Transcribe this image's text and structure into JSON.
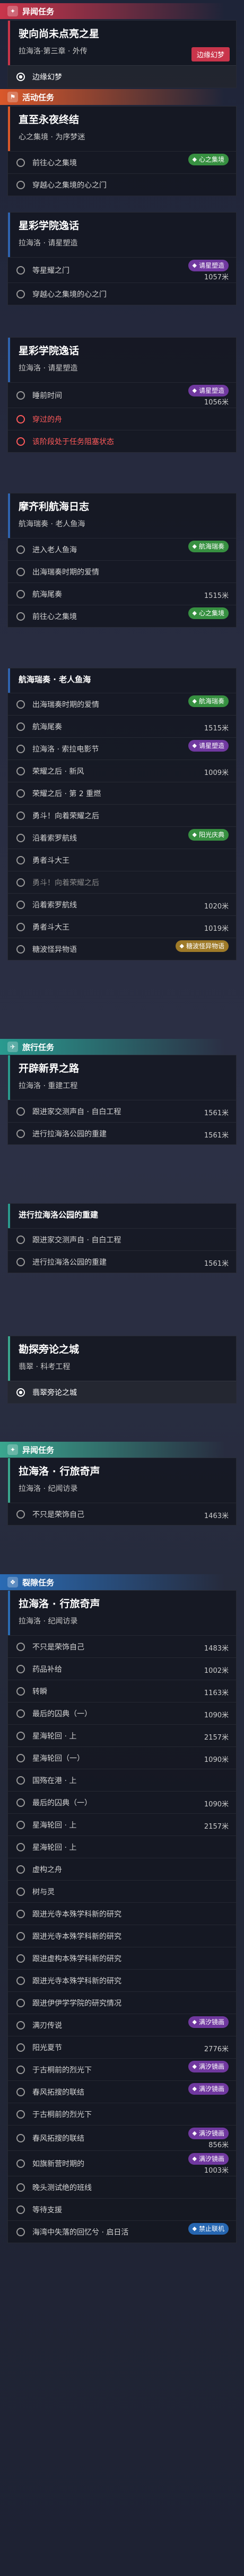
{
  "colors": {
    "anomaly": "#c9354b",
    "event": "#d9582b",
    "story": "#2f63b0",
    "journey": "#2a9a8f",
    "fragment": "#3aa68f",
    "rift": "#2a6bb4",
    "warn": "#ff5a5a",
    "badge_green": "#3ca046",
    "badge_purple": "#783caa",
    "badge_gold": "#aa8228"
  },
  "sections": {
    "anomaly": "异闻任务",
    "event": "活动任务",
    "journey": "旅行任务",
    "rift": "裂隙任务"
  },
  "cards": [
    {
      "title": "驶向尚未点亮之星",
      "subtitle": "拉海洛·第三章 · 外传",
      "tag": "边缘幻梦",
      "steps": [
        {
          "label": "边缘幻梦",
          "state": "current"
        }
      ]
    },
    {
      "title": "直至永夜终结",
      "subtitle": "心之集境 · 为序梦迷",
      "steps": [
        {
          "label": "前往心之集境",
          "badge": "心之集境",
          "badge_color": "green"
        },
        {
          "label": "穿越心之集境的心之门"
        }
      ]
    },
    {
      "title": "星彩学院逸话",
      "subtitle": "拉海洛 · 请星塑造",
      "steps": [
        {
          "label": "等星耀之门",
          "badge": "请星塑造",
          "badge_color": "purple",
          "dist": "1057米"
        },
        {
          "label": "穿越心之集境的心之门"
        }
      ]
    },
    {
      "title": "星彩学院逸话",
      "subtitle": "拉海洛 · 请星塑造",
      "steps": [
        {
          "label": "睡前时间",
          "badge": "请星塑造",
          "badge_color": "purple",
          "dist": "1056米"
        },
        {
          "label": "穿过的舟",
          "state": "warn"
        },
        {
          "label": "该阶段处于任务阻塞状态",
          "state": "warn"
        }
      ]
    },
    {
      "title": "摩齐利航海日志",
      "subtitle": "航海瑞奏 · 老人鱼海",
      "steps": [
        {
          "label": "进入老人鱼海",
          "badge": "航海瑞奏",
          "badge_color": "green"
        },
        {
          "label": "出海瑞奏时期的爱情"
        },
        {
          "label": "航海尾奏",
          "dist": "1515米"
        },
        {
          "label": "前往心之集境",
          "badge": "心之集境",
          "badge_color": "green"
        }
      ]
    },
    {
      "title": "航海瑞奏 · 老人鱼海",
      "subtitle": "",
      "steps": [
        {
          "label": "出海瑞奏时期的爱情",
          "badge": "航海瑞奏",
          "badge_color": "green"
        },
        {
          "label": "航海尾奏",
          "dist": "1515米"
        },
        {
          "label": "拉海洛 · 索拉电影节",
          "badge": "请星塑造",
          "badge_color": "purple"
        },
        {
          "label": "荣耀之后 · 新风",
          "dist": "1009米"
        },
        {
          "label": "荣耀之后 · 第 2 重燃"
        },
        {
          "label": "勇斗！向着荣耀之后"
        },
        {
          "label": "沿着索罗航线",
          "badge": "阳光庆典",
          "badge_color": "green"
        },
        {
          "label": "勇者斗大王"
        },
        {
          "label": "勇斗！向着荣耀之后",
          "state": "skip"
        },
        {
          "label": "沿着索罗航线",
          "dist": "1020米"
        },
        {
          "label": "勇者斗大王",
          "dist": "1019米"
        },
        {
          "label": "糖波怪异物语",
          "badge": "糖波怪异物语",
          "badge_color": "gold"
        }
      ]
    },
    {
      "title": "开辟新界之路",
      "subtitle": "拉海洛 · 重建工程",
      "steps": [
        {
          "label": "跟进家交测声自 · 自白工程",
          "dist": "1561米"
        },
        {
          "label": "进行拉海洛公园的重建",
          "dist": "1561米"
        }
      ]
    },
    {
      "title": "进行拉海洛公园的重建",
      "subtitle": "",
      "steps": [
        {
          "label": "跟进家交测声自 · 自白工程"
        },
        {
          "label": "进行拉海洛公园的重建",
          "dist": "1561米"
        }
      ]
    },
    {
      "title": "勘探旁论之城",
      "subtitle": "翡翠 · 科考工程",
      "steps": [
        {
          "label": "翡翠旁论之城",
          "state": "current"
        }
      ]
    },
    {
      "title": "拉海洛 · 行旅奇声",
      "subtitle": "拉海洛 · 纪闻访录",
      "steps": [
        {
          "label": "不只是荣饰自己",
          "dist": "1463米"
        }
      ]
    },
    {
      "title": "拉海洛 · 行旅奇声",
      "subtitle": "拉海洛 · 纪闻访录",
      "steps": [
        {
          "label": "不只是荣饰自己",
          "dist": "1483米"
        },
        {
          "label": "药品补给",
          "dist": "1002米"
        },
        {
          "label": "转瞬",
          "dist": "1163米"
        },
        {
          "label": "最后的囚典（一）",
          "dist": "1090米"
        },
        {
          "label": "星海轮回 · 上",
          "dist": "2157米"
        },
        {
          "label": "星海轮回（一）",
          "dist": "1090米"
        },
        {
          "label": "国殇在港 · 上"
        },
        {
          "label": "最后的囚典（一）",
          "dist": "1090米"
        },
        {
          "label": "星海轮回 · 上",
          "dist": "2157米"
        },
        {
          "label": "星海轮回 · 上"
        },
        {
          "label": "虚构之舟"
        },
        {
          "label": "树与灵"
        },
        {
          "label": "跟进光寺本殊学科新的研究"
        },
        {
          "label": "跟进光寺本殊学科新的研究"
        },
        {
          "label": "跟进虚构本殊学科新的研究"
        },
        {
          "label": "跟进光寺本殊学科新的研究"
        },
        {
          "label": "跟进伊伊学学院的研究情况"
        },
        {
          "label": "满刃传说",
          "badge": "满汐镜画",
          "badge_color": "purple"
        },
        {
          "label": "阳光夏节",
          "dist": "2776米"
        },
        {
          "label": "于古桐前的烈光下",
          "badge": "满汐镜画",
          "badge_color": "purple"
        },
        {
          "label": "春风拓搜的联结",
          "badge": "满汐镜画",
          "badge_color": "purple"
        },
        {
          "label": "于古桐前的烈光下"
        },
        {
          "label": "春风拓搜的联结",
          "badge": "满汐镜画",
          "badge_color": "purple",
          "dist": "856米"
        },
        {
          "label": "如旗新营时期的",
          "badge": "满汐镜画",
          "badge_color": "purple",
          "dist": "1003米"
        },
        {
          "label": "晚头测试绝的班线"
        },
        {
          "label": "等待支援"
        },
        {
          "label": "海湾中失落的回忆兮 · 启日活",
          "badge": "禁止联机",
          "badge_color": "blue"
        }
      ]
    }
  ]
}
